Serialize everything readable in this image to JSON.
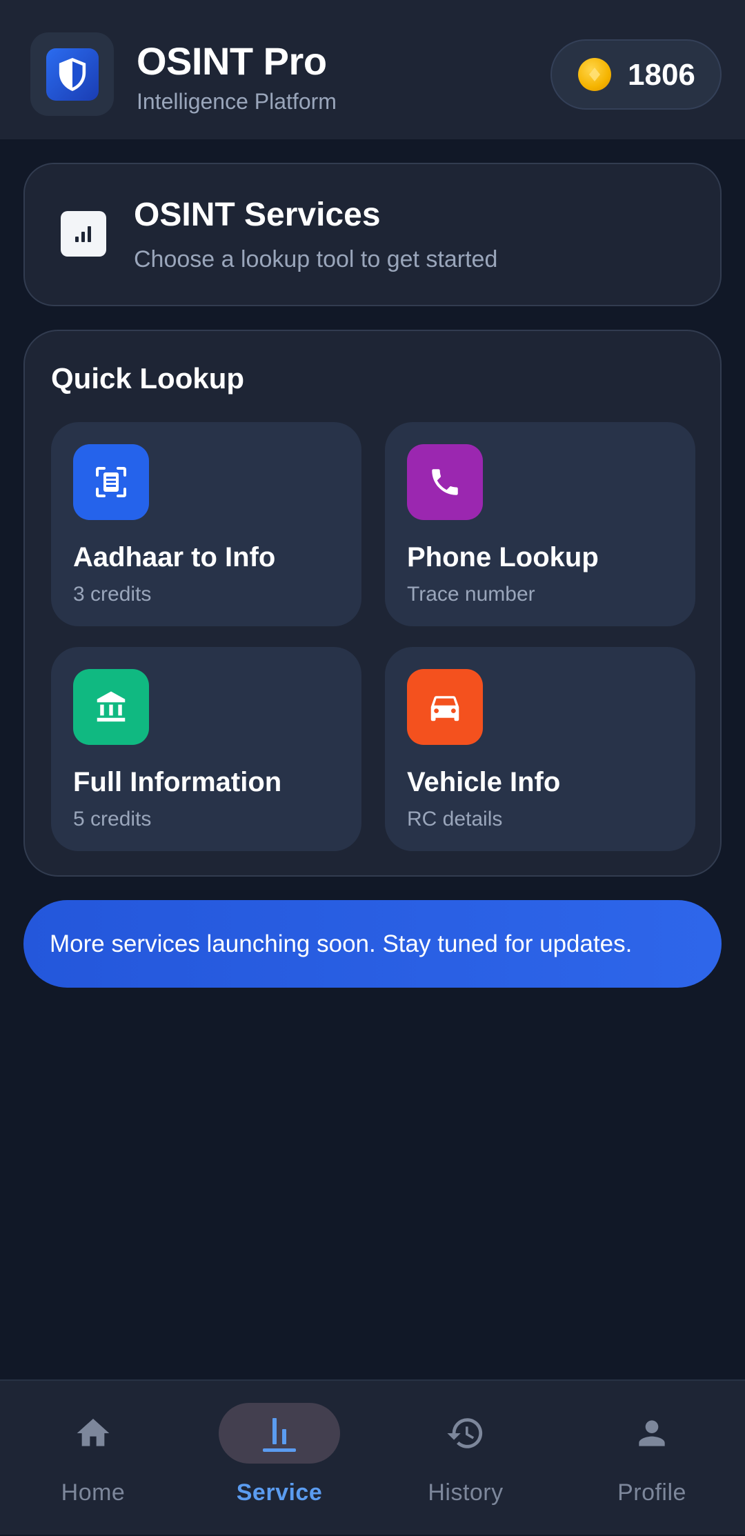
{
  "header": {
    "title": "OSINT Pro",
    "subtitle": "Intelligence Platform",
    "logo_icon": "shield-icon",
    "credits": "1806",
    "credits_icon": "coin-icon"
  },
  "services": {
    "icon": "bar-chart-icon",
    "title": "OSINT Services",
    "subtitle": "Choose a lookup tool to get started"
  },
  "quick_lookup": {
    "title": "Quick Lookup",
    "items": [
      {
        "title": "Aadhaar to Info",
        "subtitle": "3 credits",
        "icon": "document-scan-icon",
        "color": "#2563eb"
      },
      {
        "title": "Phone Lookup",
        "subtitle": "Trace number",
        "icon": "phone-icon",
        "color": "#9b27b0"
      },
      {
        "title": "Full Information",
        "subtitle": "5 credits",
        "icon": "bank-icon",
        "color": "#10b981"
      },
      {
        "title": "Vehicle Info",
        "subtitle": "RC details",
        "icon": "car-icon",
        "color": "#f4511e"
      }
    ]
  },
  "banner": {
    "text": "More services launching soon. Stay tuned for updates."
  },
  "bottom_nav": {
    "items": [
      {
        "label": "Home",
        "icon": "home-icon",
        "active": false
      },
      {
        "label": "Service",
        "icon": "bar-chart-icon",
        "active": true
      },
      {
        "label": "History",
        "icon": "history-icon",
        "active": false
      },
      {
        "label": "Profile",
        "icon": "person-icon",
        "active": false
      }
    ]
  },
  "colors": {
    "background": "#111827",
    "surface": "#1e2535",
    "accent": "#5b9cf0",
    "banner": "#2563eb"
  }
}
